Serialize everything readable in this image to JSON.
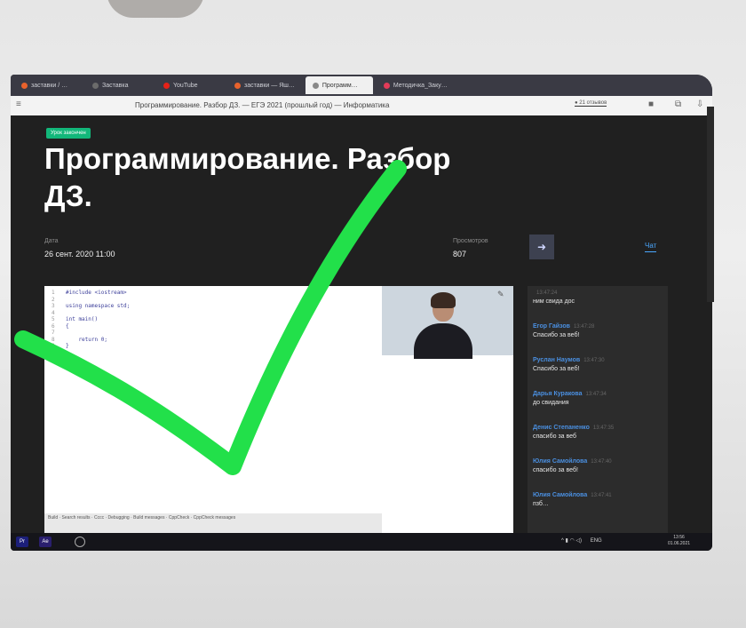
{
  "browser": {
    "tabs": [
      {
        "label": "заставки / …",
        "color": "#e8622c",
        "active": false
      },
      {
        "label": "Заставка",
        "color": "#6b6b6b",
        "active": false
      },
      {
        "label": "YouTube",
        "color": "#e62117",
        "active": false
      },
      {
        "label": "заставки — Яш…",
        "color": "#e8622c",
        "active": false
      },
      {
        "label": "Программ…",
        "color": "#888888",
        "active": true
      },
      {
        "label": "Методичка_Заку…",
        "color": "#e23b58",
        "active": false
      }
    ],
    "page_title": "Программирование. Разбор ДЗ. — ЕГЭ 2021 (прошлый год) — Информатика",
    "reviews_label": "● 21 отзывов"
  },
  "lesson": {
    "status_badge": "Урок закончен",
    "title": "Программирование. Разбор ДЗ.",
    "date_label": "Дата",
    "date_value": "26 сент. 2020 11:00",
    "views_label": "Просмотров",
    "views_value": "807",
    "share_icon": "share-arrow-icon",
    "chat_tab_label": "Чат"
  },
  "code": {
    "lines": [
      {
        "n": "1",
        "text": "#include <iostream>"
      },
      {
        "n": "2",
        "text": ""
      },
      {
        "n": "3",
        "text": "using namespace std;"
      },
      {
        "n": "4",
        "text": ""
      },
      {
        "n": "5",
        "text": "int main()"
      },
      {
        "n": "6",
        "text": "{"
      },
      {
        "n": "7",
        "text": ""
      },
      {
        "n": "8",
        "text": "    return 0;"
      },
      {
        "n": "9",
        "text": "}"
      },
      {
        "n": "10",
        "text": ""
      },
      {
        "n": "11",
        "text": ""
      }
    ],
    "status_text": "Build · Search results · Cccc · Debugging · Build messages · CppCheck · CppCheck messages"
  },
  "chat": {
    "messages": [
      {
        "name": "",
        "time": "13:47:24",
        "text": "ним свида дос"
      },
      {
        "name": "Егор Гайзов",
        "time": "13:47:28",
        "text": "Спасибо за веб!"
      },
      {
        "name": "Руслан Наумов",
        "time": "13:47:30",
        "text": "Спасибо за веб!"
      },
      {
        "name": "Дарья Куракова",
        "time": "13:47:34",
        "text": "до свидания"
      },
      {
        "name": "Денис Степаненко",
        "time": "13:47:35",
        "text": "спасибо за веб"
      },
      {
        "name": "Юлия Самойлова",
        "time": "13:47:40",
        "text": "спасибо за веб!"
      },
      {
        "name": "Юлия Самойлова",
        "time": "13:47:41",
        "text": "пзб…"
      }
    ]
  },
  "taskbar": {
    "apps": [
      {
        "label": "Pr",
        "color": "#1c1f7a"
      },
      {
        "label": "Ae",
        "color": "#2a1f6e"
      }
    ],
    "lang": "ENG",
    "time": "13:56",
    "date": "01.06.2021"
  },
  "overlay": {
    "checkmark_color": "#22e04a"
  }
}
